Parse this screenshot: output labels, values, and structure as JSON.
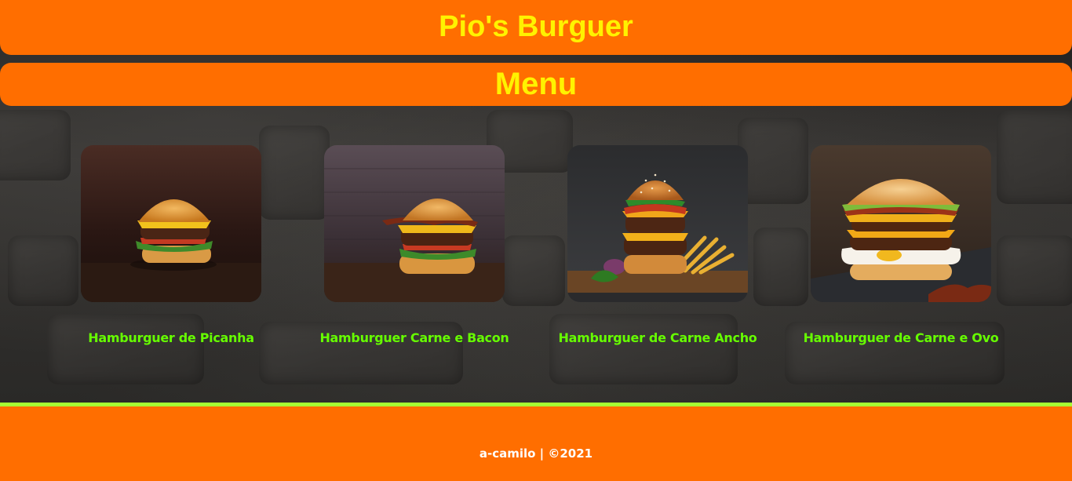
{
  "header": {
    "title": "Pio's Burguer"
  },
  "menu": {
    "title": "Menu",
    "items": [
      {
        "name": "Hamburguer de Picanha",
        "image": "burger-picanha-photo"
      },
      {
        "name": "Hamburguer Carne e Bacon",
        "image": "burger-bacon-photo"
      },
      {
        "name": "Hamburguer de Carne Ancho",
        "image": "burger-ancho-photo"
      },
      {
        "name": "Hamburguer de Carne e Ovo",
        "image": "burger-egg-photo"
      }
    ]
  },
  "footer": {
    "text": "a-camilo | ©2021"
  },
  "colors": {
    "accent": "#ff6e00",
    "title": "#fff200",
    "caption": "#66ff00",
    "divider": "#a6ff33"
  }
}
